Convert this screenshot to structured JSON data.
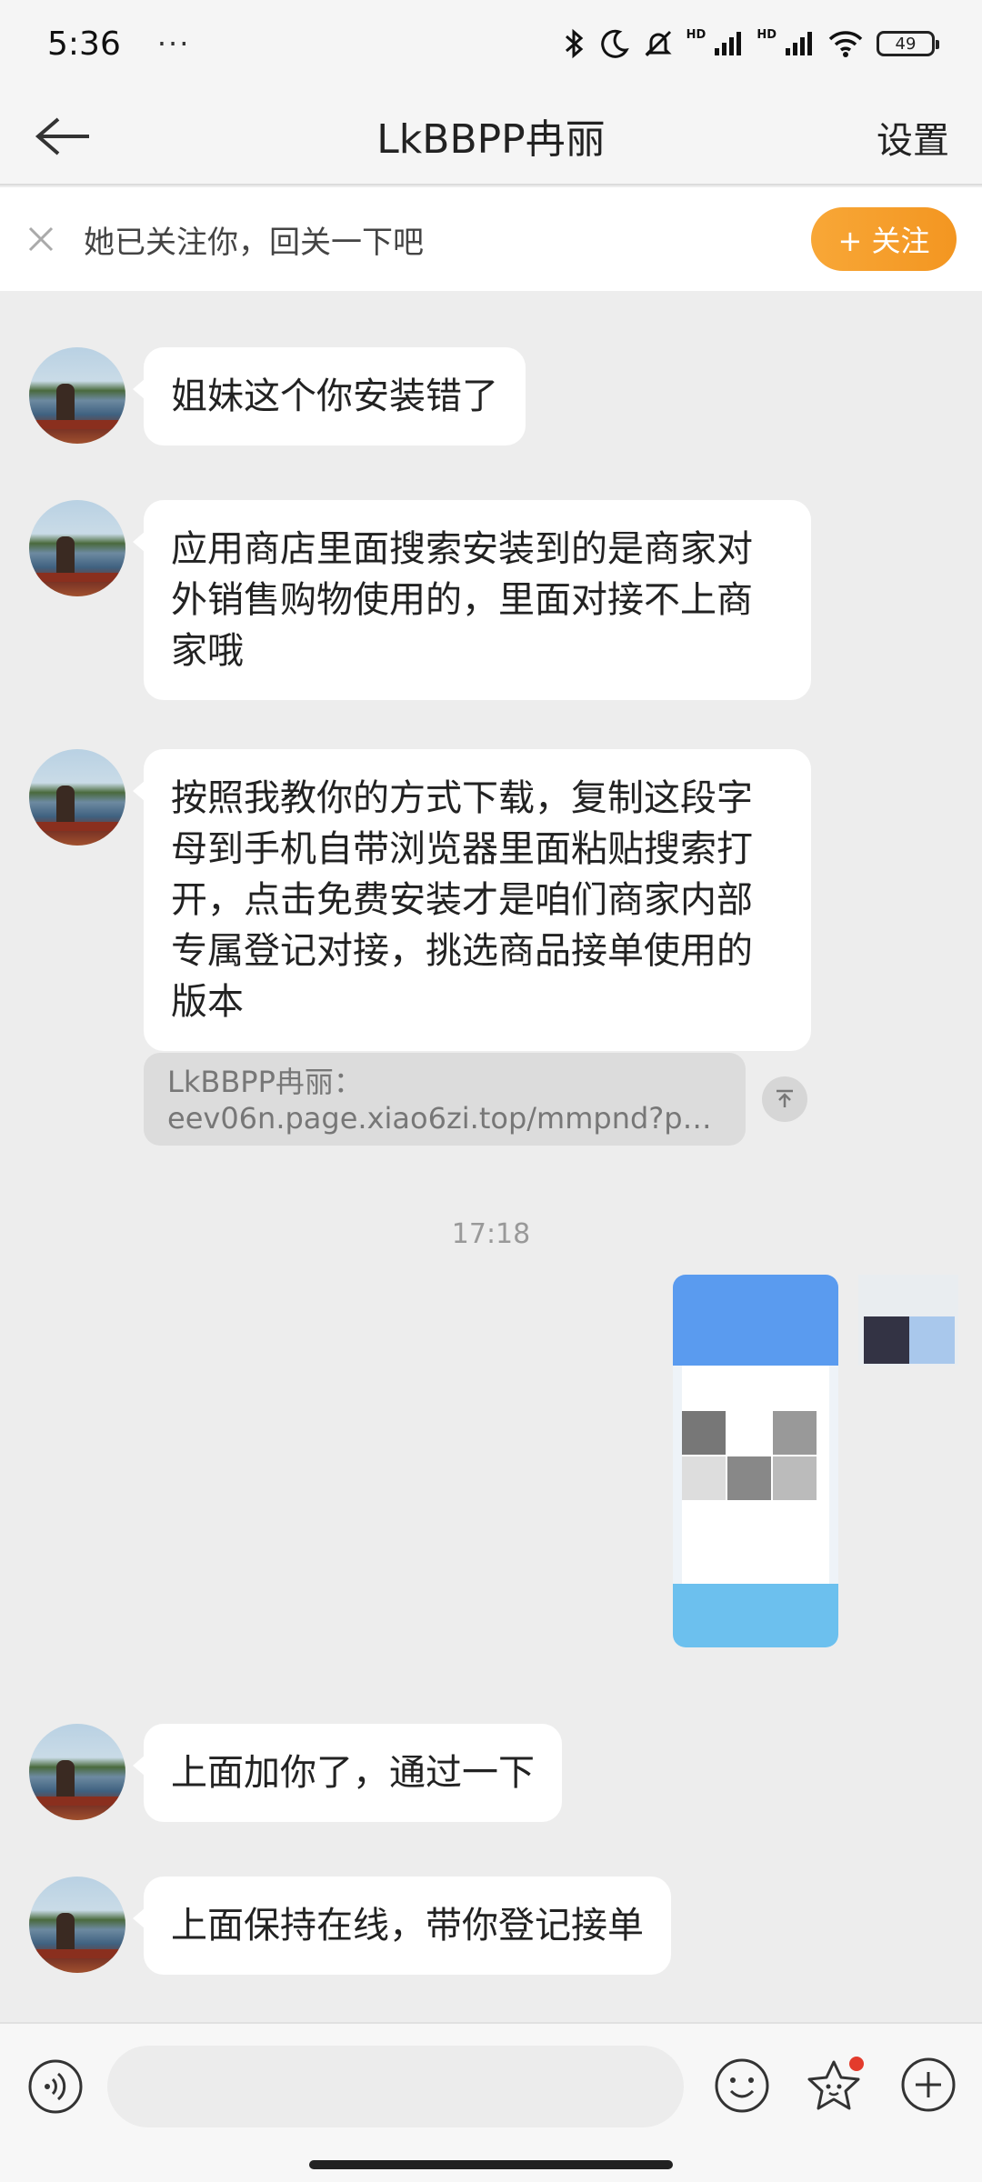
{
  "status_bar": {
    "time": "5:36",
    "dots": "···",
    "battery": "49",
    "hd1": "HD",
    "hd2": "HD"
  },
  "header": {
    "title": "LkBBPP冉丽",
    "settings_label": "设置"
  },
  "follow_banner": {
    "text": "她已关注你，回关一下吧",
    "button_label": "+ 关注",
    "accent_color": "#F39621"
  },
  "messages": [
    {
      "text": "姐妹这个你安装错了"
    },
    {
      "lines": [
        "应用商店里面搜索安装到的是商家对",
        "外销售购物使用的，里面对接不上商",
        "家哦"
      ]
    },
    {
      "lines": [
        "按照我教你的方式下载，复制这段字",
        "母到手机自带浏览器里面粘贴搜索打",
        "开，点击免费安装才是咱们商家内部",
        "专属登记对接，挑选商品接单使用的",
        "版本"
      ]
    },
    {
      "text": "上面加你了，通过一下"
    },
    {
      "text": "上面保持在线，带你登记接单"
    }
  ],
  "quote": {
    "sender": "LkBBPP冉丽：",
    "content": "eev06n.page.xiao6zi.top/mmpnd?p=..."
  },
  "timestamp": "17:18",
  "input": {
    "placeholder": ""
  }
}
